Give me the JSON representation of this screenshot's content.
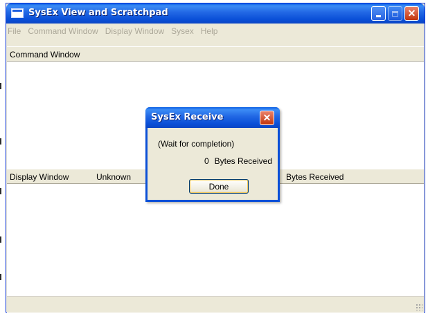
{
  "window": {
    "title": "SysEx View and Scratchpad"
  },
  "menubar": {
    "items": [
      "File",
      "Command Window",
      "Display Window",
      "Sysex",
      "Help"
    ]
  },
  "command_pane": {
    "label": "Command Window"
  },
  "display_pane": {
    "label": "Display Window",
    "type_label": "Unknown",
    "bytes_label": "Bytes Received"
  },
  "dialog": {
    "title": "SysEx Receive",
    "message": "(Wait for completion)",
    "count": "0",
    "count_label": "Bytes Received",
    "button_label": "Done"
  },
  "icons": {
    "app": "window-icon",
    "minimize": "minimize-icon",
    "maximize": "maximize-icon",
    "close": "close-icon",
    "resize": "resize-grip-icon"
  },
  "colors": {
    "titlebar": "#0a4fd7",
    "face": "#ece9d8",
    "disabled_text": "#aca899",
    "close_button": "#c2350c"
  }
}
